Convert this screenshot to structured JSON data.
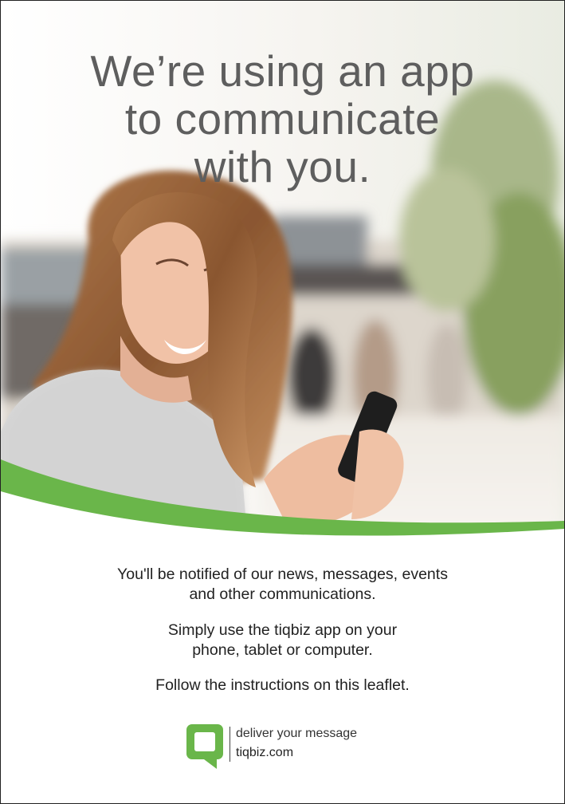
{
  "headline": [
    "We’re using an app",
    "to communicate",
    "with you."
  ],
  "paragraphs": [
    [
      "You'll be notified of our news, messages, events",
      "and other communications."
    ],
    [
      "Simply use the tiqbiz app on your",
      "phone, tablet or computer."
    ],
    [
      "Follow the instructions on this leaflet."
    ]
  ],
  "logo": {
    "tagline": "deliver your message",
    "domain": "tiqbiz.com",
    "icon": "speech-bubble-q-icon"
  },
  "colors": {
    "brand_green": "#6ab64a",
    "headline_gray": "#5e5e5e",
    "text": "#222222"
  }
}
